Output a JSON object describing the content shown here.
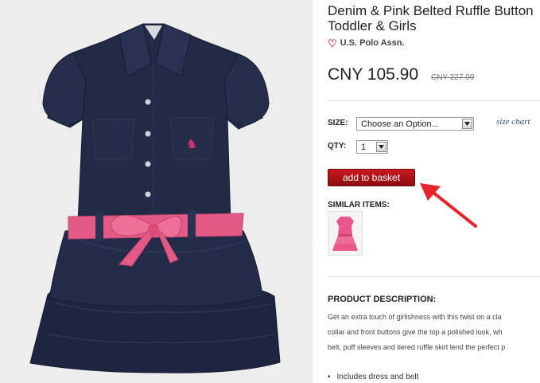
{
  "product": {
    "title_line1": "Denim & Pink Belted Ruffle Button",
    "title_line2": "Toddler & Girls",
    "brand": "U.S. Polo Assn.",
    "price": "CNY 105.90",
    "old_price": "CNY 227.09"
  },
  "options": {
    "size_label": "SIZE:",
    "size_value": "Choose an Option...",
    "size_chart": "size chart",
    "qty_label": "QTY:",
    "qty_value": "1"
  },
  "actions": {
    "add_to_basket": "add to basket"
  },
  "similar": {
    "label": "SIMILAR ITEMS:"
  },
  "description": {
    "heading": "PRODUCT DESCRIPTION:",
    "lines": [
      "Get an extra touch of girlishness with this twist on a cla",
      "collar and front buttons give the top a polished look, wh",
      "belt, puff sleeves and tiered ruffle skirt lend the perfect p"
    ],
    "bullets": [
      "Includes dress and belt"
    ]
  },
  "icons": {
    "heart": "heart-outline-icon",
    "arrow": "red-pointer-arrow"
  },
  "colors": {
    "button_red": "#b3141a",
    "heart_pink": "#c0395a",
    "link_blue": "#2a4f8a",
    "denim": "#1f2640",
    "belt_pink": "#e35a86"
  }
}
